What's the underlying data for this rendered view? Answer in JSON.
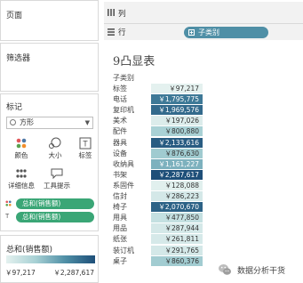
{
  "panels": {
    "pages": "页面",
    "filters": "筛选器",
    "marks": "标记",
    "legend": "总和(销售额)"
  },
  "marks_card": {
    "mark_type": "方形",
    "buttons": [
      {
        "label": "颜色",
        "icon": "color-dots-icon"
      },
      {
        "label": "大小",
        "icon": "size-icon"
      },
      {
        "label": "标签",
        "icon": "label-T-icon"
      },
      {
        "label": "详细信息",
        "icon": "detail-dots-icon"
      },
      {
        "label": "工具提示",
        "icon": "tooltip-bubble-icon"
      }
    ],
    "pills": [
      {
        "text": "总和(销售额)",
        "icon": "color-dots-icon"
      },
      {
        "text": "总和(销售额)",
        "icon": "label-T-icon"
      }
    ]
  },
  "legend": {
    "min_label": "￥97,217",
    "max_label": "￥2,287,617",
    "colors": [
      "#e4f1ef",
      "#1e4f79"
    ]
  },
  "shelves": {
    "columns": "列",
    "rows": "行",
    "row_pill": "子类别"
  },
  "view": {
    "title": "9凸显表",
    "field_header": "子类别",
    "rows": [
      {
        "label": "标签",
        "value": "￥97,217",
        "v": 97217
      },
      {
        "label": "电话",
        "value": "￥1,795,775",
        "v": 1795775
      },
      {
        "label": "复印机",
        "value": "￥1,969,576",
        "v": 1969576
      },
      {
        "label": "美术",
        "value": "￥197,026",
        "v": 197026
      },
      {
        "label": "配件",
        "value": "￥800,880",
        "v": 800880
      },
      {
        "label": "器具",
        "value": "￥2,133,616",
        "v": 2133616
      },
      {
        "label": "设备",
        "value": "￥876,630",
        "v": 876630
      },
      {
        "label": "收纳具",
        "value": "￥1,161,227",
        "v": 1161227
      },
      {
        "label": "书架",
        "value": "￥2,287,617",
        "v": 2287617
      },
      {
        "label": "系固件",
        "value": "￥128,088",
        "v": 128088
      },
      {
        "label": "信封",
        "value": "￥286,223",
        "v": 286223
      },
      {
        "label": "椅子",
        "value": "￥2,070,670",
        "v": 2070670
      },
      {
        "label": "用具",
        "value": "￥477,850",
        "v": 477850
      },
      {
        "label": "用品",
        "value": "￥287,944",
        "v": 287944
      },
      {
        "label": "纸张",
        "value": "￥261,811",
        "v": 261811
      },
      {
        "label": "装订机",
        "value": "￥291,765",
        "v": 291765
      },
      {
        "label": "桌子",
        "value": "￥860,376",
        "v": 860376
      }
    ]
  },
  "watermark": {
    "text": "数据分析干货",
    "icon": "wechat-logo-icon"
  }
}
